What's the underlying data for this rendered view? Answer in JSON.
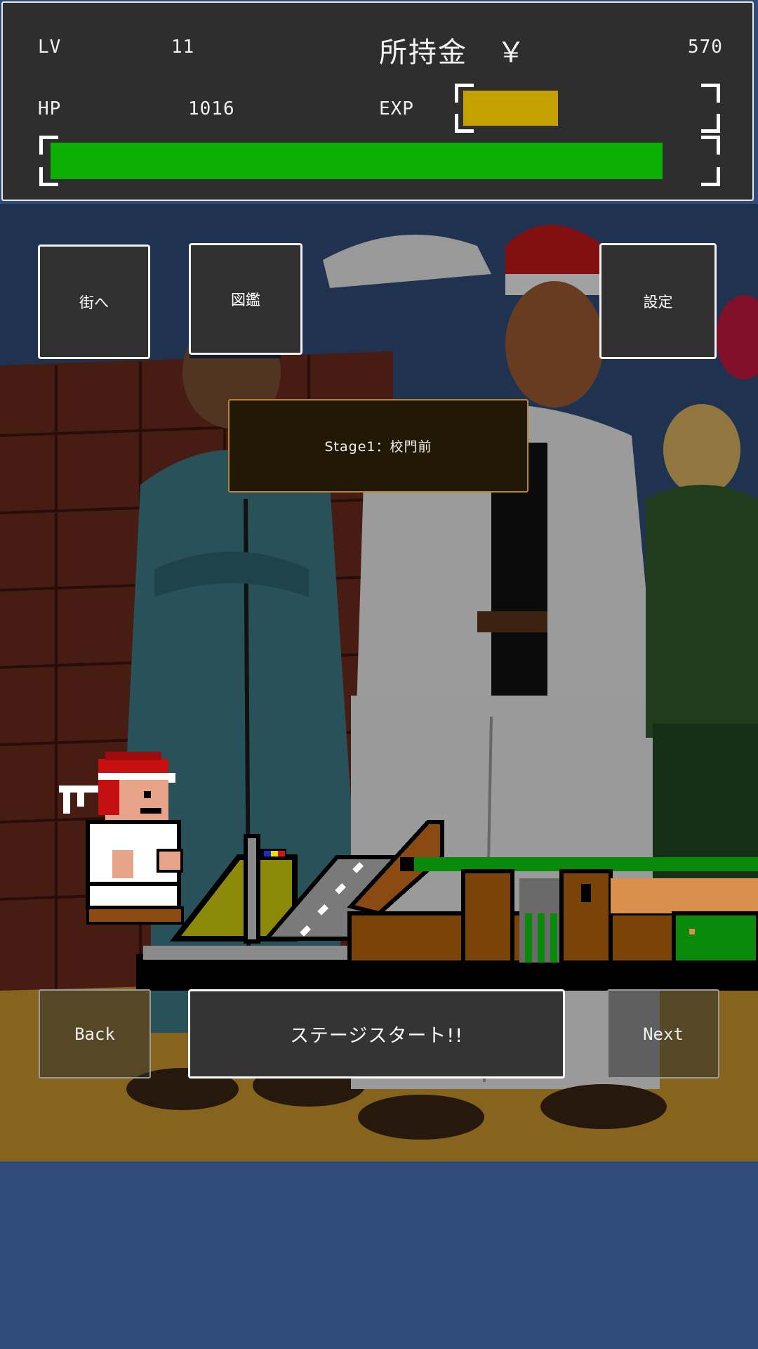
{
  "hud": {
    "lv_label": "LV",
    "lv_value": "11",
    "money_label": "所持金　￥",
    "money_value": "570",
    "hp_label": "HP",
    "hp_value": "1016",
    "exp_label": "EXP",
    "hp_fill": 0.93,
    "exp_fill": 0.38,
    "hp_color": "#0caf04",
    "exp_color": "#c4a000"
  },
  "menu": {
    "town_label": "街へ",
    "encyclopedia_label": "図鑑",
    "settings_label": "設定"
  },
  "stage": {
    "name": "Stage1：校門前"
  },
  "nav": {
    "back_label": "Back",
    "start_label": "ステージスタート!!",
    "next_label": "Next"
  },
  "colors": {
    "background": "#2f4c7a",
    "panel": "#2e2e2e",
    "stage_border": "#b8862a"
  }
}
